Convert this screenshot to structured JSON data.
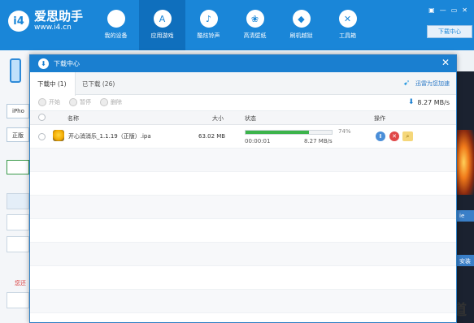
{
  "app": {
    "logo_badge": "i4",
    "logo_name": "爱思助手",
    "logo_url": "www.i4.cn"
  },
  "nav": [
    {
      "label": "我的设备",
      "icon": "apple-icon",
      "glyph": "",
      "active": false
    },
    {
      "label": "应用游戏",
      "icon": "app-store-icon",
      "glyph": "A",
      "active": true
    },
    {
      "label": "酷炫铃声",
      "icon": "bell-icon",
      "glyph": "♪",
      "active": false
    },
    {
      "label": "高清壁纸",
      "icon": "wallpaper-icon",
      "glyph": "❀",
      "active": false
    },
    {
      "label": "刷机越狱",
      "icon": "flash-icon",
      "glyph": "◆",
      "active": false
    },
    {
      "label": "工具箱",
      "icon": "toolbox-icon",
      "glyph": "✕",
      "active": false
    }
  ],
  "window_controls": [
    "▣",
    "—",
    "▭",
    "✕"
  ],
  "top_download_button": "下载中心",
  "background": {
    "chip1": "iPho",
    "chip2": "正版",
    "red_text": "您还",
    "right_btn1": "ie",
    "right_btn2": "安装",
    "watermark": "百度知道"
  },
  "dialog": {
    "title": "下载中心",
    "close": "✕",
    "tabs": {
      "downloading": "下载中 (1)",
      "downloaded": "已下载 (26)"
    },
    "xunlei_label": "迅雷为您加速",
    "toolbar": {
      "start": "开始",
      "pause": "暂停",
      "delete": "删除"
    },
    "speed": "8.27 MB/s",
    "columns": {
      "name": "名称",
      "size": "大小",
      "status": "状态",
      "action": "操作"
    },
    "rows": [
      {
        "name": "开心消消乐_1.1.19（正版）.ipa",
        "size": "63.02 MB",
        "progress_percent": 74,
        "progress_label": "74%",
        "elapsed": "00:00:01",
        "speed": "8.27 MB/s"
      }
    ]
  }
}
